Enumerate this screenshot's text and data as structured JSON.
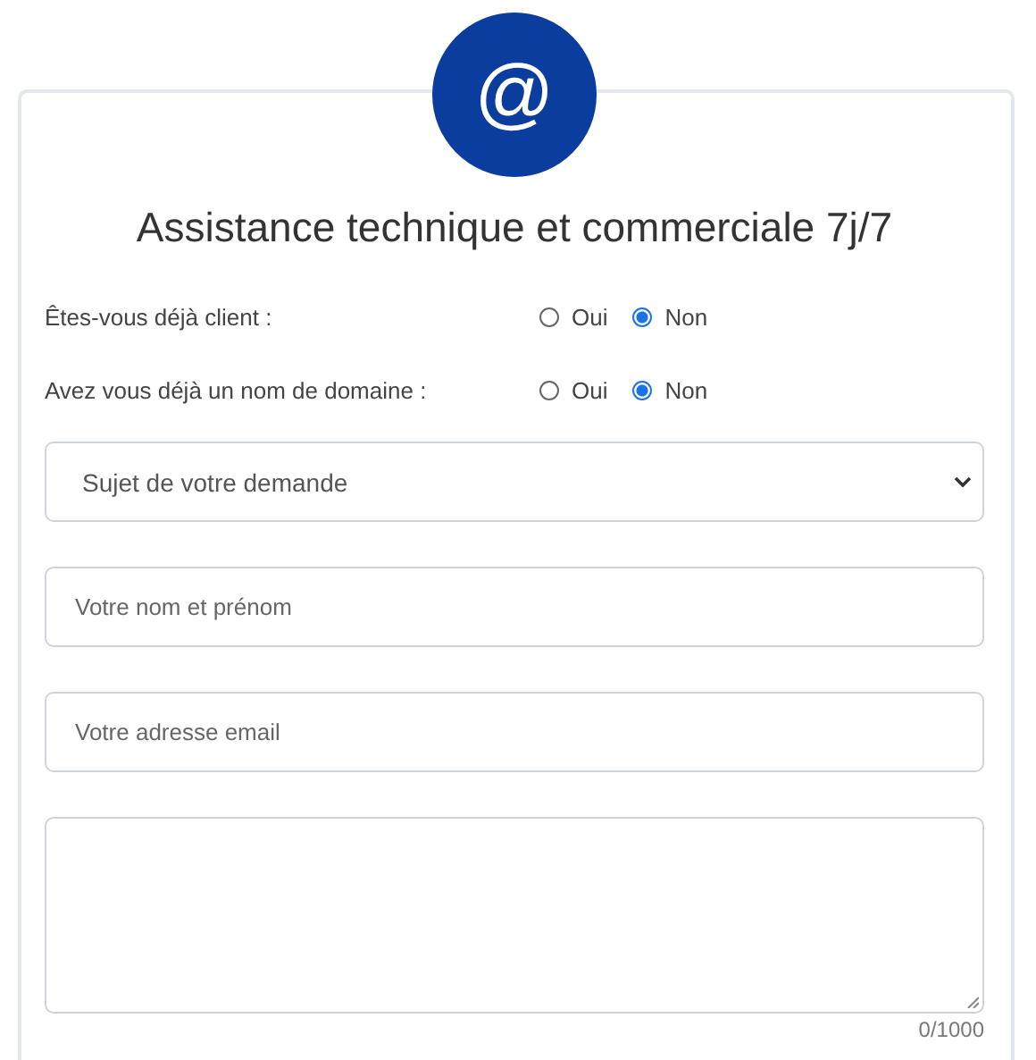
{
  "badge": {
    "symbol": "@"
  },
  "title": "Assistance technique et commerciale 7j/7",
  "questions": [
    {
      "label": "Êtes-vous déjà client :",
      "options": [
        {
          "label": "Oui",
          "selected": false
        },
        {
          "label": "Non",
          "selected": true
        }
      ]
    },
    {
      "label": "Avez vous déjà un nom de domaine :",
      "options": [
        {
          "label": "Oui",
          "selected": false
        },
        {
          "label": "Non",
          "selected": true
        }
      ]
    }
  ],
  "subject_select": {
    "value": "Sujet de votre demande"
  },
  "fields": [
    {
      "placeholder": "Votre nom et prénom"
    },
    {
      "placeholder": "Votre adresse email"
    }
  ],
  "message": {
    "counter": "0/1000"
  }
}
